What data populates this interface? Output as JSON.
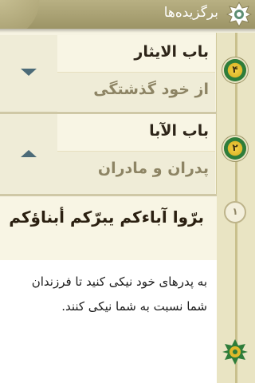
{
  "header": {
    "title": "برگزیده‌ها"
  },
  "items": [
    {
      "badge": "۴",
      "title": "باب الایثار",
      "subtitle": "از خود گذشتگی",
      "toggle": "down-arrow-icon"
    },
    {
      "badge": "۲",
      "title": "باب الآبا",
      "subtitle": "پدران و مادران",
      "toggle": "up-arrow-icon"
    }
  ],
  "verse": {
    "badge": "۱",
    "arabic": "برّوا آباءکم یبرّکم أبناؤکم"
  },
  "translation": {
    "text": "به پدرهای خود نیکی کنید تا فرزندان شما نسبت به شما نیکی کنند."
  },
  "colors": {
    "header": "#a39c6e",
    "badge_green": "#2e7d3a",
    "badge_gold": "#e0b92b",
    "rail": "#e9e4c3"
  }
}
